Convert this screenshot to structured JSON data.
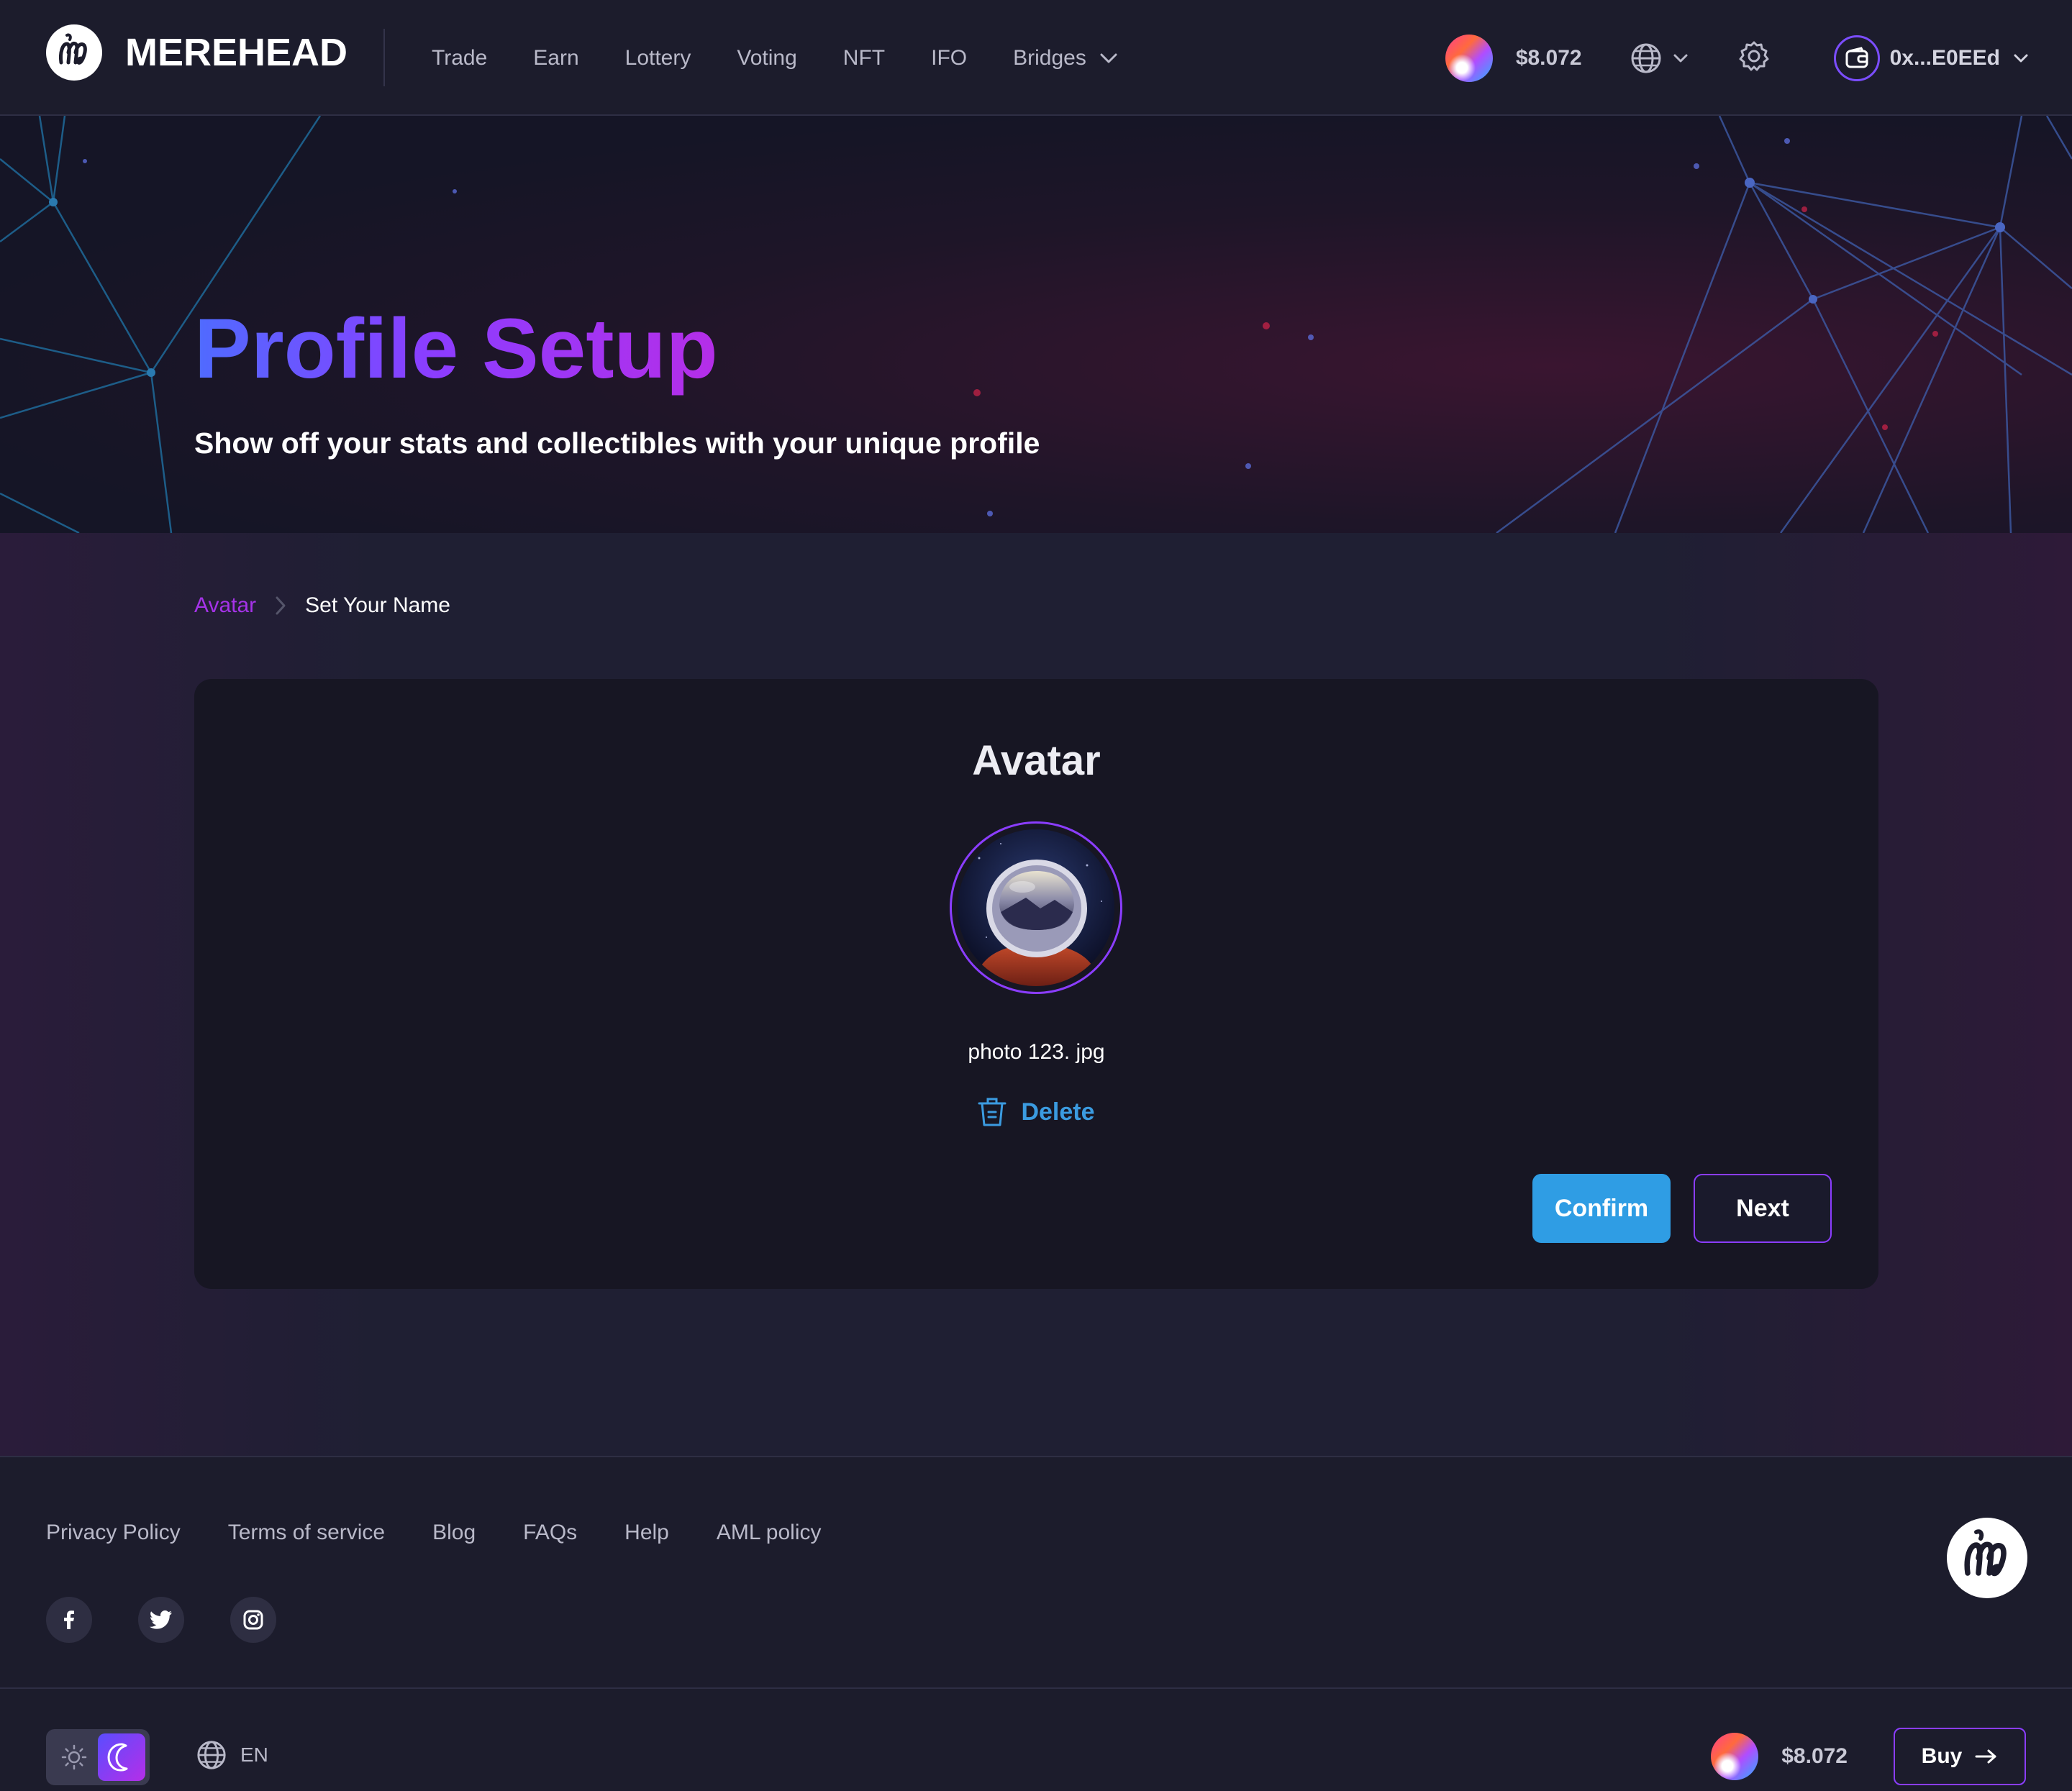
{
  "header": {
    "brand": "MEREHEAD",
    "nav": [
      "Trade",
      "Earn",
      "Lottery",
      "Voting",
      "NFT",
      "IFO",
      "Bridges"
    ],
    "price": "$8.072",
    "wallet_address": "0x...E0EEd"
  },
  "hero": {
    "title": "Profile Setup",
    "subtitle": "Show off your stats and collectibles with your unique profile"
  },
  "breadcrumb": {
    "current": "Avatar",
    "next": "Set Your Name"
  },
  "card": {
    "title": "Avatar",
    "file_name": "photo 123. jpg",
    "delete_label": "Delete",
    "confirm_label": "Confirm",
    "next_label": "Next"
  },
  "footer": {
    "links": [
      "Privacy Policy",
      "Terms of service",
      "Blog",
      "FAQs",
      "Help",
      "AML policy"
    ],
    "language": "EN",
    "price": "$8.072",
    "buy_label": "Buy"
  },
  "colors": {
    "accent_purple": "#8b3dff",
    "accent_blue": "#2f9de4",
    "background": "#1d1d30"
  }
}
